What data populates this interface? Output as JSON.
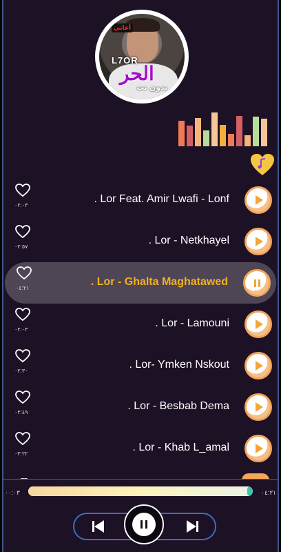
{
  "album": {
    "tag_text": "أغاني",
    "brand_text": "L7OR",
    "title_big": "الحر",
    "title_small": "بدون نت"
  },
  "equalizer": {
    "bars": [
      0.72,
      0.58,
      0.78,
      0.45,
      0.94,
      0.6,
      0.35,
      0.85,
      0.3,
      0.82,
      0.76
    ]
  },
  "colors": {
    "background": "#1d1126",
    "accent": "#f3a537",
    "active_title": "#f2b21f",
    "border_blue": "#3d5f98",
    "eq_palette": [
      "#f07a52",
      "#d45f66",
      "#f4b67a",
      "#b8dd9a",
      "#f6c59a",
      "#f2b03a"
    ]
  },
  "tracks": [
    {
      "title": ". Lor Feat. Amir Lwafi - Lonf",
      "duration": "٠٢:٠٣",
      "active": false
    },
    {
      "title": ". Lor - Netkhayel",
      "duration": "٠٢:٥٧",
      "active": false
    },
    {
      "title": ". Lor - Ghalta Maghatawed",
      "duration": "٠٤:٢١",
      "active": true
    },
    {
      "title": ". Lor - Lamouni",
      "duration": "٠٢:٠٣",
      "active": false
    },
    {
      "title": ". Lor- Ymken Nskout",
      "duration": "٠٢:٣٠",
      "active": false
    },
    {
      "title": ". Lor - Besbab Dema",
      "duration": "٠٣:٤٩",
      "active": false
    },
    {
      "title": ". Lor - Khab L_amal",
      "duration": "٠٣:٢٢",
      "active": false
    }
  ],
  "player": {
    "current_time": "٠٠:٠٣",
    "total_time": "٠٤:٢١",
    "progress": 0.99
  },
  "icons": {
    "heart": "heart-outline-icon",
    "play": "play-icon",
    "pause": "pause-icon",
    "previous": "skip-previous-icon",
    "next": "skip-next-icon",
    "favorites": "music-heart-icon"
  }
}
